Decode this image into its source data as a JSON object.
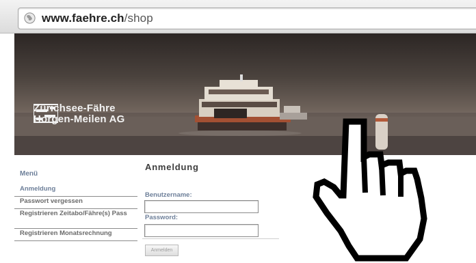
{
  "browser": {
    "url_domain": "www.faehre.ch",
    "url_path": "/shop"
  },
  "banner": {
    "logo_line1": "Zürichsee-Fähre",
    "logo_line2": "Horgen-Meilen AG"
  },
  "menu": {
    "title": "Menü",
    "items": [
      {
        "label": "Anmeldung"
      },
      {
        "label": "Passwort vergessen"
      },
      {
        "label": "Registrieren Zeitabo/Fähre(s) Pass"
      },
      {
        "label": "Registrieren Monatsrechnung"
      }
    ]
  },
  "login": {
    "title": "Anmeldung",
    "username_label": "Benutzername:",
    "username_value": "",
    "password_label": "Password:",
    "password_value": "",
    "submit_label": "Anmelden"
  },
  "colors": {
    "accent": "#6d7f99",
    "menu_text": "#6a6a6a"
  },
  "icons": [
    "globe-icon",
    "ferry-logo-icon",
    "hand-cursor-icon"
  ]
}
